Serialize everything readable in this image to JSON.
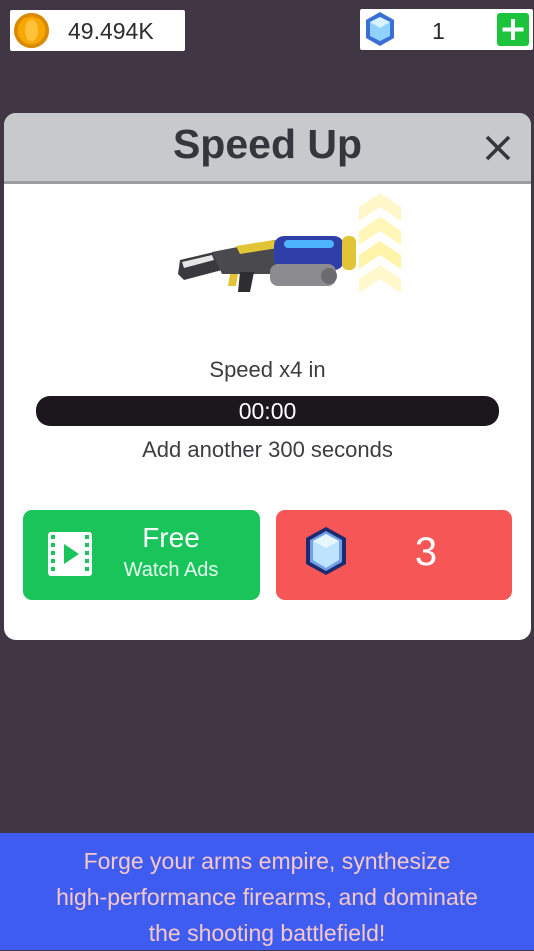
{
  "top_bar": {
    "coins": "49.494K",
    "gems": "1",
    "coin_icon": "coin-icon",
    "gem_icon": "gem-icon",
    "add_icon": "plus-icon"
  },
  "dialog": {
    "title": "Speed Up",
    "close_icon": "close-icon",
    "speed_label": "Speed x4 in",
    "timer": "00:00",
    "add_label": "Add another 300 seconds",
    "free_button": {
      "title": "Free",
      "subtitle": "Watch Ads",
      "icon": "video-icon"
    },
    "gem_button": {
      "cost": "3",
      "icon": "gem-icon"
    }
  },
  "banner": {
    "line1": "Forge your arms empire, synthesize",
    "line2": "high-performance firearms, and dominate",
    "line3": "the shooting battlefield!"
  },
  "colors": {
    "background": "#403644",
    "free_button": "#19c45b",
    "gem_button": "#f65656",
    "banner": "#3f5cf0",
    "plus_button": "#1cc43c"
  }
}
